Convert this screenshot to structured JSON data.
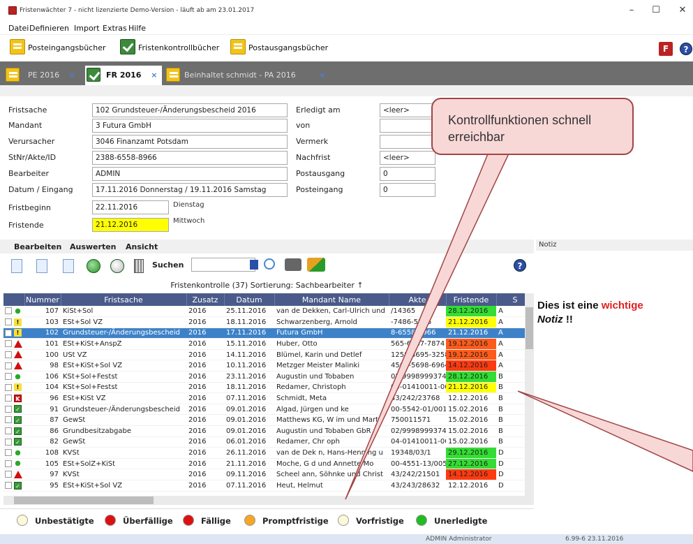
{
  "window": {
    "title": "Fristenwächter 7 - nicht lizenzierte Demo-Version - läuft ab am 23.01.2017",
    "minimize": "–",
    "maximize": "☐",
    "close": "✕"
  },
  "menu": [
    "Datei",
    "Definieren",
    "Import",
    "Extras",
    "Hilfe"
  ],
  "toolbar": {
    "posteingang": "Posteingangsbücher",
    "fristenkontrolle": "Fristenkontrollbücher",
    "postausgang": "Postausgangsbücher",
    "help": "?",
    "logo": "F"
  },
  "tabs": [
    {
      "label": "PE 2016",
      "close": "×"
    },
    {
      "label": "FR 2016",
      "close": "×"
    },
    {
      "label": "Beinhaltet schmidt - PA 2016",
      "close": "×"
    }
  ],
  "form": {
    "fristsache": {
      "label": "Fristsache",
      "value": "102 Grundsteuer-/Änderungsbescheid 2016"
    },
    "mandant": {
      "label": "Mandant",
      "value": "3 Futura GmbH"
    },
    "verursacher": {
      "label": "Verursacher",
      "value": "3046 Finanzamt Potsdam"
    },
    "stnr": {
      "label": "StNr/Akte/ID",
      "value": "2388-6558-8966"
    },
    "bearbeiter": {
      "label": "Bearbeiter",
      "value": "ADMIN"
    },
    "datum": {
      "label": "Datum / Eingang",
      "value": "17.11.2016 Donnerstag / 19.11.2016 Samstag"
    },
    "fristbeginn": {
      "label": "Fristbeginn",
      "value": "22.11.2016",
      "day": "Dienstag"
    },
    "fristende": {
      "label": "Fristende",
      "value": "21.12.2016",
      "day": "Mittwoch"
    },
    "erledigt": {
      "label": "Erledigt am",
      "value": "<leer>"
    },
    "von": {
      "label": "von",
      "value": ""
    },
    "vermerk": {
      "label": "Vermerk",
      "value": ""
    },
    "nachfrist": {
      "label": "Nachfrist",
      "value": "<leer>"
    },
    "postausgang": {
      "label": "Postausgang",
      "value": "0"
    },
    "posteingang": {
      "label": "Posteingang",
      "value": "0"
    }
  },
  "editbar": [
    "Bearbeiten",
    "Auswerten",
    "Ansicht"
  ],
  "search": {
    "label": "Suchen",
    "value": ""
  },
  "grid": {
    "title": "Fristenkontrolle  (37)  Sortierung:  Sachbearbeiter ↑",
    "headers": [
      "",
      "Nummer",
      "Fristsache",
      "Zusatz",
      "Datum",
      "Mandant Name",
      "Akte",
      "Fristende",
      "S"
    ],
    "rows": [
      {
        "icon": "green",
        "num": "107",
        "fs": "KiSt+Sol",
        "z": "2016",
        "d": "25.11.2016",
        "m": "van de Dekken, Carl-Ulrich und",
        "a": "/14365",
        "fe": "28.12.2016",
        "fc": "green",
        "s": "A"
      },
      {
        "icon": "yellow",
        "num": "103",
        "fs": "ESt+Sol VZ",
        "z": "2016",
        "d": "18.11.2016",
        "m": "Schwarzenberg, Arnold",
        "a": "-7486-5236",
        "fe": "21.12.2016",
        "fc": "yellow",
        "s": "A"
      },
      {
        "icon": "yellow",
        "num": "102",
        "fs": "Grundsteuer-/Änderungsbescheid",
        "z": "2016",
        "d": "17.11.2016",
        "m": "Futura GmbH",
        "a": "8-6558-8966",
        "fe": "21.12.2016",
        "fc": "plain",
        "s": "A",
        "sel": true
      },
      {
        "icon": "red",
        "num": "101",
        "fs": "ESt+KiSt+AnspZ",
        "z": "2016",
        "d": "15.11.2016",
        "m": "Huber, Otto",
        "a": "565-6667-7874",
        "fe": "19.12.2016",
        "fc": "orange",
        "s": "A"
      },
      {
        "icon": "red",
        "num": "100",
        "fs": "USt VZ",
        "z": "2016",
        "d": "14.11.2016",
        "m": "Blümel, Karin und Detlef",
        "a": "1258-3695-3258",
        "fe": "19.12.2016",
        "fc": "orange",
        "s": "A"
      },
      {
        "icon": "red",
        "num": "98",
        "fs": "ESt+KiSt+Sol VZ",
        "z": "2016",
        "d": "10.11.2016",
        "m": "Metzger Meister Malinki",
        "a": "4568-5698-6964",
        "fe": "14.12.2016",
        "fc": "red",
        "s": "A"
      },
      {
        "icon": "green",
        "num": "106",
        "fs": "KSt+Sol+Festst",
        "z": "2016",
        "d": "23.11.2016",
        "m": "Augustin und Tobaben",
        "a": "02/9998999374",
        "fe": "28.12.2016",
        "fc": "green",
        "s": "B"
      },
      {
        "icon": "yellow",
        "num": "104",
        "fs": "KSt+Sol+Festst",
        "z": "2016",
        "d": "18.11.2016",
        "m": "Redamer, Christoph",
        "a": "04-01410011-00",
        "fe": "21.12.2016",
        "fc": "yellow",
        "s": "B"
      },
      {
        "icon": "x",
        "num": "96",
        "fs": "ESt+KiSt VZ",
        "z": "2016",
        "d": "07.11.2016",
        "m": "Schmidt, Meta",
        "a": "43/242/23768",
        "fe": "12.12.2016",
        "fc": "plain",
        "s": "B"
      },
      {
        "icon": "done",
        "num": "91",
        "fs": "Grundsteuer-/Änderungsbescheid",
        "z": "2016",
        "d": "09.01.2016",
        "m": "Algad, Jürgen und ke",
        "a": "00-5542-01/001",
        "fe": "15.02.2016",
        "fc": "plain",
        "s": "B"
      },
      {
        "icon": "done",
        "num": "87",
        "fs": "GewSt",
        "z": "2016",
        "d": "09.01.2016",
        "m": "Matthews KG, W im und Mart",
        "a": "750011571",
        "fe": "15.02.2016",
        "fc": "plain",
        "s": "B"
      },
      {
        "icon": "done",
        "num": "86",
        "fs": "Grundbesitzabgabe",
        "z": "2016",
        "d": "09.01.2016",
        "m": "Augustin und Tobaben GbR",
        "a": "02/9998999374",
        "fe": "15.02.2016",
        "fc": "plain",
        "s": "B"
      },
      {
        "icon": "done",
        "num": "82",
        "fs": "GewSt",
        "z": "2016",
        "d": "06.01.2016",
        "m": "Redamer, Chr oph",
        "a": "04-01410011-00",
        "fe": "15.02.2016",
        "fc": "plain",
        "s": "B"
      },
      {
        "icon": "green",
        "num": "108",
        "fs": "KVSt",
        "z": "2016",
        "d": "26.11.2016",
        "m": "van de Dek n, Hans-Henning u",
        "a": "19348/03/1",
        "fe": "29.12.2016",
        "fc": "green",
        "s": "D"
      },
      {
        "icon": "green",
        "num": "105",
        "fs": "ESt+SolZ+KiSt",
        "z": "2016",
        "d": "21.11.2016",
        "m": "Moche, G d und Annette Mo",
        "a": "00-4551-13/005",
        "fe": "27.12.2016",
        "fc": "green",
        "s": "D"
      },
      {
        "icon": "red",
        "num": "97",
        "fs": "KVSt",
        "z": "2016",
        "d": "09.11.2016",
        "m": "Scheel ann, Söhnke und Christ",
        "a": "43/242/21501",
        "fe": "14.12.2016",
        "fc": "red",
        "s": "D"
      },
      {
        "icon": "done",
        "num": "95",
        "fs": "ESt+KiSt+Sol VZ",
        "z": "2016",
        "d": "07.11.2016",
        "m": "Heut, Helmut",
        "a": "43/243/28632",
        "fe": "12.12.2016",
        "fc": "plain",
        "s": "D"
      }
    ]
  },
  "legend": [
    {
      "label": "Unbestätigte",
      "color": "#fff8d8"
    },
    {
      "label": "Überfällige",
      "color": "#dd1010"
    },
    {
      "label": "Fällige",
      "color": "#dd1010"
    },
    {
      "label": "Promptfristige",
      "color": "#f5a623"
    },
    {
      "label": "Vorfristige",
      "color": "#fff8d8"
    },
    {
      "label": "Unerledigte",
      "color": "#22bb22"
    }
  ],
  "notiz": {
    "header": "Notiz",
    "text_pre": "Dies ist eine ",
    "text_red": "wichtige",
    "text_post_bold_italic": "Notiz",
    "text_end": " !!"
  },
  "callout": "Kontrollfunktionen schnell erreichbar",
  "statusbar": {
    "user": "ADMIN  Administrator",
    "version": "6.99-6 23.11.2016"
  },
  "colors": {
    "accent": "#4a5a8a",
    "selection": "#3d82c8",
    "callout_bg": "#f8d7d7",
    "callout_border": "#a04545"
  }
}
